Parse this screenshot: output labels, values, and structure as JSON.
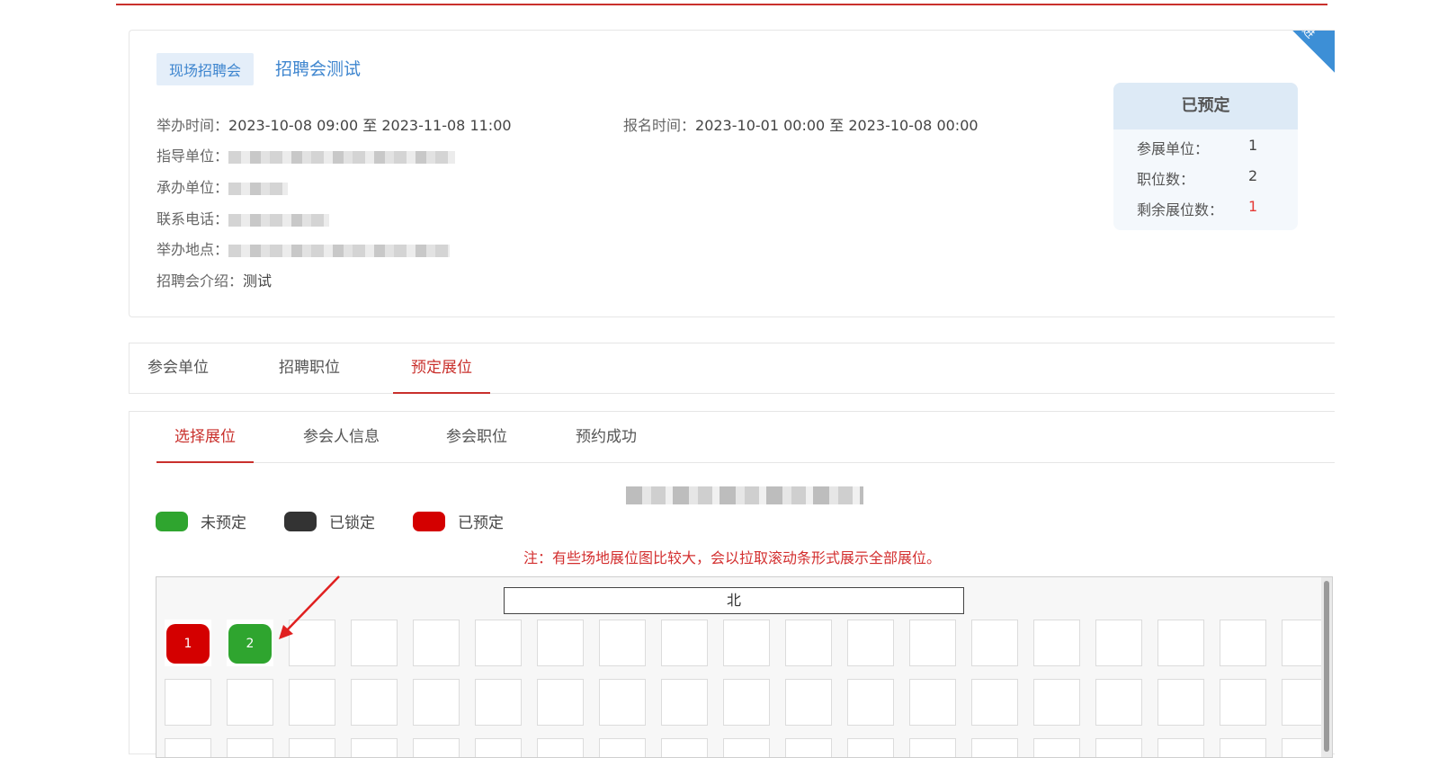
{
  "event": {
    "type_tag": "现场招聘会",
    "title": "招聘会测试",
    "corner_badge": "进",
    "hold_time_label": "举办时间：",
    "hold_time_value": "2023-10-08 09:00 至 2023-11-08 11:00",
    "signup_time_label": "报名时间：",
    "signup_time_value": "2023-10-01 00:00 至 2023-10-08 00:00",
    "guide_unit_label": "指导单位：",
    "host_unit_label": "承办单位：",
    "phone_label": "联系电话：",
    "location_label": "举办地点：",
    "intro_label": "招聘会介绍：",
    "intro_value": "测试"
  },
  "stats": {
    "header": "已预定",
    "exhibitors_label": "参展单位：",
    "exhibitors_value": "1",
    "positions_label": "职位数：",
    "positions_value": "2",
    "remaining_label": "剩余展位数：",
    "remaining_value": "1",
    "remaining_color": "#e53935"
  },
  "main_tabs": [
    {
      "label": "参会单位",
      "active": false
    },
    {
      "label": "招聘职位",
      "active": false
    },
    {
      "label": "预定展位",
      "active": true
    }
  ],
  "steps": [
    {
      "label": "选择展位",
      "active": true
    },
    {
      "label": "参会人信息",
      "active": false
    },
    {
      "label": "参会职位",
      "active": false
    },
    {
      "label": "预约成功",
      "active": false
    }
  ],
  "legend": [
    {
      "label": "未预定",
      "color": "#2fa52f"
    },
    {
      "label": "已锁定",
      "color": "#333333"
    },
    {
      "label": "已预定",
      "color": "#d40000"
    }
  ],
  "note": "注：有些场地展位图比较大，会以拉取滚动条形式展示全部展位。",
  "map": {
    "north_label": "北",
    "booths": [
      {
        "number": "1",
        "status": "booked",
        "color": "#d40000"
      },
      {
        "number": "2",
        "status": "available",
        "color": "#2fa52f"
      }
    ]
  },
  "colors": {
    "accent_red": "#c9302c",
    "link_blue": "#3f86cf"
  }
}
